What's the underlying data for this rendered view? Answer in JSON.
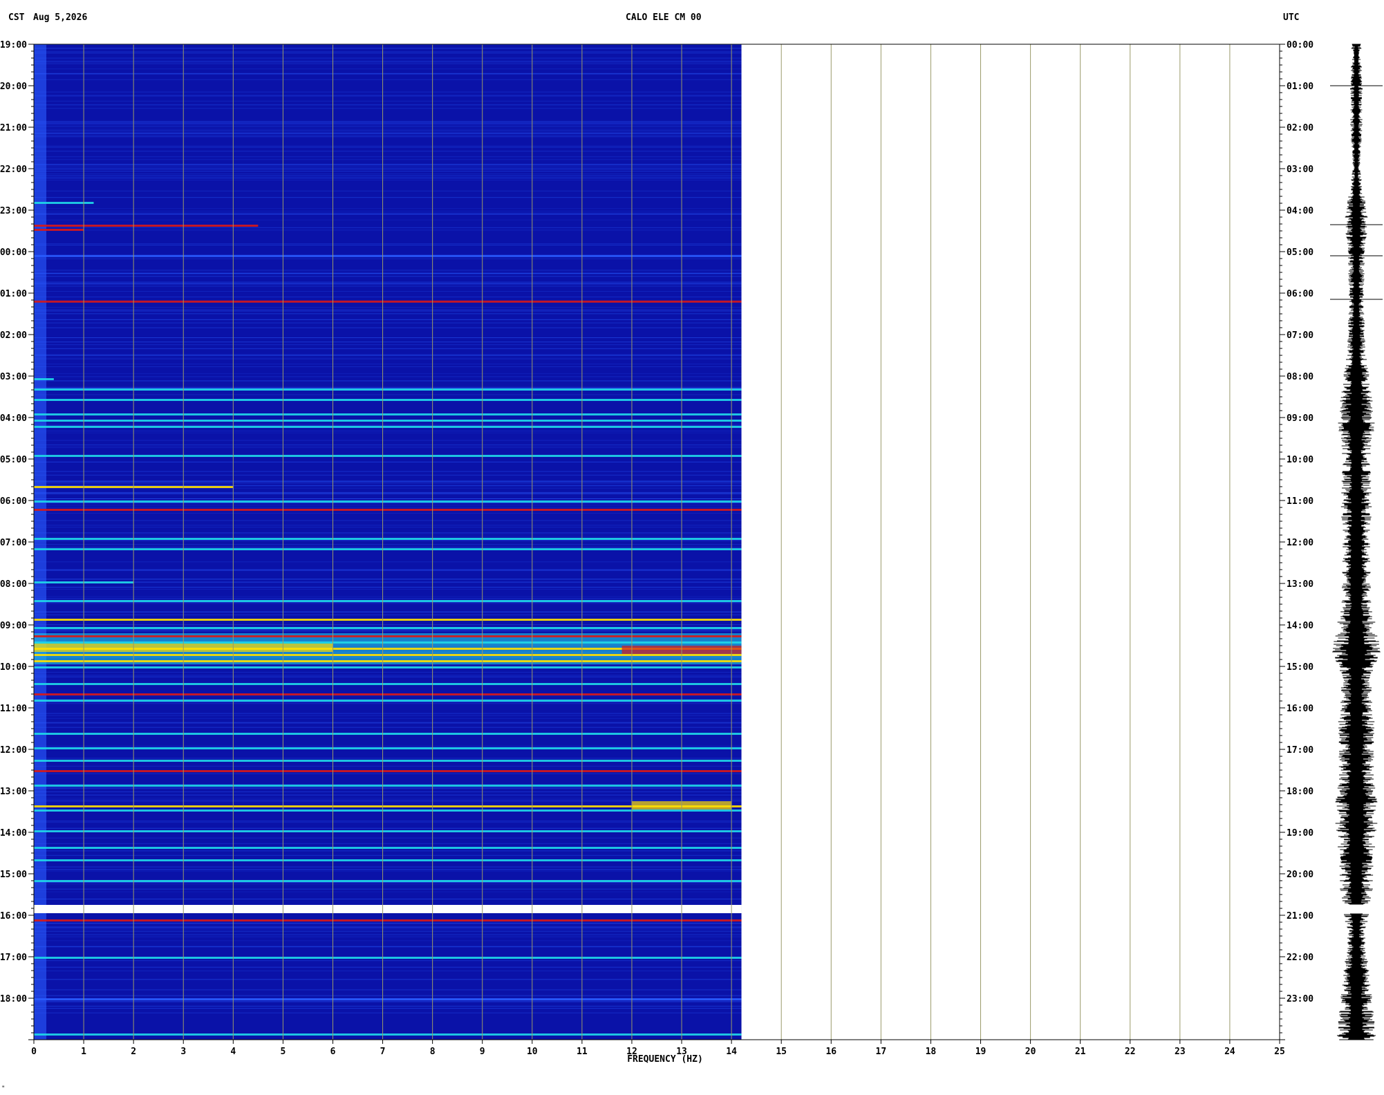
{
  "header": {
    "tz_left": "CST",
    "date": "Aug 5,2026",
    "station": "CALO ELE CM 00",
    "tz_right": "UTC"
  },
  "footnote": "\"",
  "colors": {
    "spectrogram_base": "#0a12a8",
    "band_low": "#2a5cff",
    "band_mid": "#1fd8e8",
    "band_high": "#ffe000",
    "band_peak": "#d81818",
    "grid": "#9a9a6a",
    "seismogram": "#000000"
  },
  "chart_data": {
    "type": "heatmap",
    "title": "CALO ELE CM 00",
    "xlabel": "FREQUENCY (HZ)",
    "x_ticks": [
      "0",
      "1",
      "2",
      "3",
      "4",
      "5",
      "6",
      "7",
      "8",
      "9",
      "10",
      "11",
      "12",
      "13",
      "14",
      "15",
      "16",
      "17",
      "18",
      "19",
      "20",
      "21",
      "22",
      "23",
      "24",
      "25"
    ],
    "xlim": [
      0,
      25
    ],
    "data_frequency_max": 14.2,
    "left_axis_label": "CST",
    "right_axis_label": "UTC",
    "y_ticks_left": [
      "19:00",
      "20:00",
      "21:00",
      "22:00",
      "23:00",
      "00:00",
      "01:00",
      "02:00",
      "03:00",
      "04:00",
      "05:00",
      "06:00",
      "07:00",
      "08:00",
      "09:00",
      "10:00",
      "11:00",
      "12:00",
      "13:00",
      "14:00",
      "15:00",
      "16:00",
      "17:00",
      "18:00"
    ],
    "y_ticks_right": [
      "00:00",
      "01:00",
      "02:00",
      "03:00",
      "04:00",
      "05:00",
      "06:00",
      "07:00",
      "08:00",
      "09:00",
      "10:00",
      "11:00",
      "12:00",
      "13:00",
      "14:00",
      "15:00",
      "16:00",
      "17:00",
      "18:00",
      "19:00",
      "20:00",
      "21:00",
      "22:00",
      "23:00"
    ],
    "ylim_hours": [
      0,
      24
    ],
    "data_gap_utc_hours": [
      20.75,
      20.95
    ],
    "bands": [
      {
        "t": 3.8,
        "fmax": 1.2,
        "level": 2
      },
      {
        "t": 4.35,
        "fmax": 4.5,
        "level": 4
      },
      {
        "t": 4.45,
        "fmax": 1.0,
        "level": 4
      },
      {
        "t": 5.08,
        "fmax": 14.2,
        "level": 1
      },
      {
        "t": 6.18,
        "fmax": 14.2,
        "level": 4
      },
      {
        "t": 8.05,
        "fmax": 0.4,
        "level": 2
      },
      {
        "t": 8.3,
        "fmax": 14.2,
        "level": 2
      },
      {
        "t": 8.55,
        "fmax": 14.2,
        "level": 2
      },
      {
        "t": 8.9,
        "fmax": 14.2,
        "level": 2
      },
      {
        "t": 9.05,
        "fmax": 14.2,
        "level": 2
      },
      {
        "t": 9.2,
        "fmax": 14.2,
        "level": 2
      },
      {
        "t": 9.9,
        "fmax": 14.2,
        "level": 2
      },
      {
        "t": 10.65,
        "fmax": 4.0,
        "level": 3
      },
      {
        "t": 11.0,
        "fmax": 14.2,
        "level": 2
      },
      {
        "t": 11.2,
        "fmax": 14.2,
        "level": 4
      },
      {
        "t": 11.9,
        "fmax": 14.2,
        "level": 2
      },
      {
        "t": 12.15,
        "fmax": 14.2,
        "level": 2
      },
      {
        "t": 12.95,
        "fmax": 2.0,
        "level": 2
      },
      {
        "t": 13.4,
        "fmax": 14.2,
        "level": 2
      },
      {
        "t": 13.85,
        "fmax": 14.2,
        "level": 3
      },
      {
        "t": 14.05,
        "fmax": 14.2,
        "level": 2
      },
      {
        "t": 14.25,
        "fmax": 14.2,
        "level": 4
      },
      {
        "t": 14.4,
        "fmax": 14.2,
        "level": 2
      },
      {
        "t": 14.55,
        "fmax": 14.2,
        "level": 3
      },
      {
        "t": 14.7,
        "fmax": 14.2,
        "level": 3
      },
      {
        "t": 14.85,
        "fmax": 14.2,
        "level": 3
      },
      {
        "t": 15.0,
        "fmax": 14.2,
        "level": 2
      },
      {
        "t": 15.4,
        "fmax": 14.2,
        "level": 2
      },
      {
        "t": 15.65,
        "fmax": 14.2,
        "level": 4
      },
      {
        "t": 15.8,
        "fmax": 14.2,
        "level": 2
      },
      {
        "t": 16.6,
        "fmax": 14.2,
        "level": 2
      },
      {
        "t": 16.95,
        "fmax": 14.2,
        "level": 2
      },
      {
        "t": 17.25,
        "fmax": 14.2,
        "level": 2
      },
      {
        "t": 17.5,
        "fmax": 14.2,
        "level": 4
      },
      {
        "t": 17.85,
        "fmax": 14.2,
        "level": 2
      },
      {
        "t": 18.35,
        "fmax": 14.2,
        "level": 3
      },
      {
        "t": 18.45,
        "fmax": 14.2,
        "level": 2
      },
      {
        "t": 18.95,
        "fmax": 14.2,
        "level": 2
      },
      {
        "t": 19.35,
        "fmax": 14.2,
        "level": 2
      },
      {
        "t": 19.65,
        "fmax": 14.2,
        "level": 2
      },
      {
        "t": 20.15,
        "fmax": 14.2,
        "level": 2
      },
      {
        "t": 21.1,
        "fmax": 14.2,
        "level": 4
      },
      {
        "t": 22.0,
        "fmax": 14.2,
        "level": 2
      },
      {
        "t": 23.0,
        "fmax": 14.2,
        "level": 1
      },
      {
        "t": 23.85,
        "fmax": 14.2,
        "level": 2
      }
    ],
    "hotspots": [
      {
        "t": 14.6,
        "f0": 11.8,
        "f1": 14.2,
        "level": 4
      },
      {
        "t": 14.55,
        "f0": 0.0,
        "f1": 6.0,
        "level": 3
      },
      {
        "t": 18.35,
        "f0": 12.0,
        "f1": 14.0,
        "level": 3
      }
    ],
    "seismogram_envelope": [
      {
        "t": 0.0,
        "amp": 0.2
      },
      {
        "t": 1.0,
        "amp": 0.25
      },
      {
        "t": 2.0,
        "amp": 0.25
      },
      {
        "t": 3.0,
        "amp": 0.15
      },
      {
        "t": 4.3,
        "amp": 0.5
      },
      {
        "t": 5.0,
        "amp": 0.35
      },
      {
        "t": 6.2,
        "amp": 0.3
      },
      {
        "t": 7.5,
        "amp": 0.4
      },
      {
        "t": 8.5,
        "amp": 0.65
      },
      {
        "t": 9.2,
        "amp": 0.75
      },
      {
        "t": 10.0,
        "amp": 0.55
      },
      {
        "t": 11.0,
        "amp": 0.65
      },
      {
        "t": 12.0,
        "amp": 0.55
      },
      {
        "t": 13.5,
        "amp": 0.6
      },
      {
        "t": 14.3,
        "amp": 0.9
      },
      {
        "t": 14.7,
        "amp": 1.0
      },
      {
        "t": 15.3,
        "amp": 0.6
      },
      {
        "t": 16.5,
        "amp": 0.75
      },
      {
        "t": 17.5,
        "amp": 0.7
      },
      {
        "t": 18.4,
        "amp": 0.9
      },
      {
        "t": 19.5,
        "amp": 0.75
      },
      {
        "t": 20.5,
        "amp": 0.65
      },
      {
        "t": 21.5,
        "amp": 0.35
      },
      {
        "t": 22.5,
        "amp": 0.55
      },
      {
        "t": 23.9,
        "amp": 0.8
      }
    ]
  }
}
